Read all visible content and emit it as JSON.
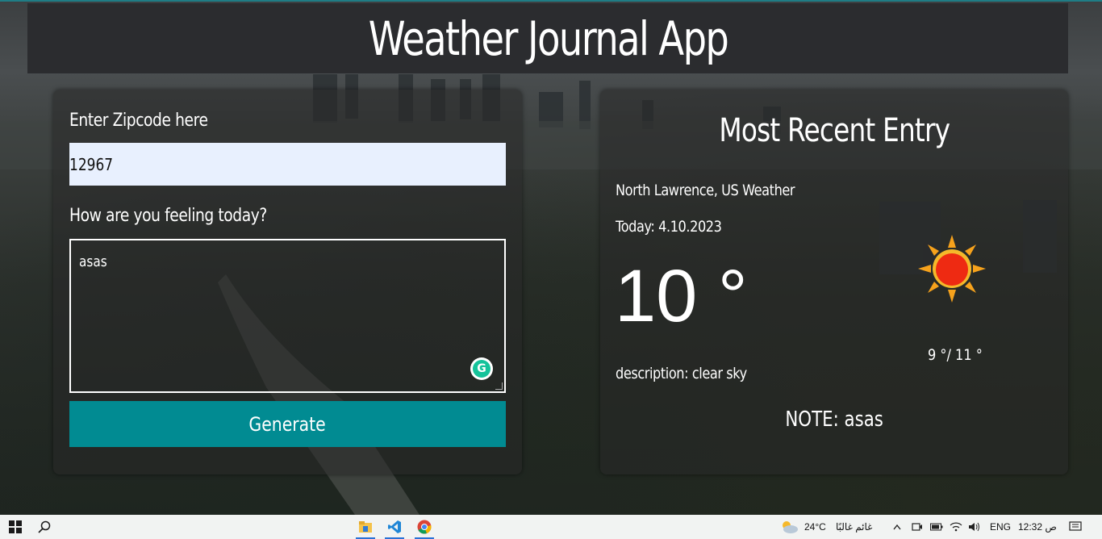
{
  "header": {
    "title": "Weather Journal App"
  },
  "form": {
    "zip_label": "Enter Zipcode here",
    "zip_value": "12967",
    "feeling_label": "How are you feeling today?",
    "feeling_value": "asas",
    "generate_label": "Generate"
  },
  "entry": {
    "title": "Most Recent Entry",
    "location": "North Lawrence, US Weather",
    "date": "Today: 4.10.2023",
    "temp": "10 °",
    "weather_icon": "sun-icon",
    "min_max": "9 °/ 11 °",
    "description": "description: clear sky",
    "note": "NOTE: asas"
  },
  "taskbar": {
    "weather_temp": "24°C",
    "weather_desc": "غائم غالبًا",
    "language": "ENG",
    "time": "12:32 ص",
    "pinned_apps": [
      "file-explorer-icon",
      "vscode-icon",
      "chrome-icon"
    ]
  },
  "colors": {
    "accent": "#018b92",
    "header_bg": "#2b2c2f",
    "input_bg": "#e8f0fe"
  }
}
